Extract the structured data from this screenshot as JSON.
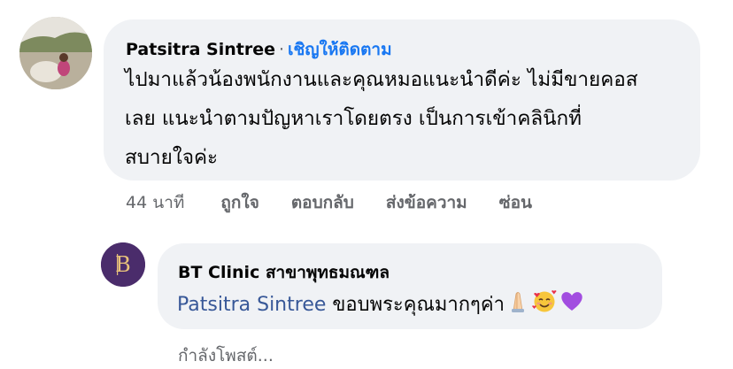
{
  "comment": {
    "author": "Patsitra Sintree",
    "separator": "·",
    "follow_label": "เชิญให้ติดตาม",
    "line1": "ไปมาแล้วน้องพนักงานและคุณหมอแนะนำดีค่ะ ไม่มีขายคอส",
    "line2": "เลย แนะนำตามปัญหาเราโดยตรง เป็นการเข้าคลินิกที่",
    "line3": "สบายใจค่ะ",
    "actions": {
      "time": "44 นาที",
      "like": "ถูกใจ",
      "reply": "ตอบกลับ",
      "message": "ส่งข้อความ",
      "hide": "ซ่อน"
    }
  },
  "reply": {
    "author": "BT Clinic สาขาพุทธมณฑล",
    "mention": "Patsitra Sintree",
    "text": " ขอบพระคุณมากๆค่า",
    "emojis": [
      "folded-hands-icon",
      "smiling-face-with-hearts-icon",
      "purple-heart-icon"
    ],
    "avatar_letter": "B",
    "status": "กำลังโพสต์..."
  },
  "colors": {
    "bubble": "#f0f2f5",
    "link": "#1877f2",
    "mention": "#385898",
    "meta": "#65676b",
    "avatar_bg": "#4a2c6b",
    "avatar_fg": "#e8c27a"
  }
}
